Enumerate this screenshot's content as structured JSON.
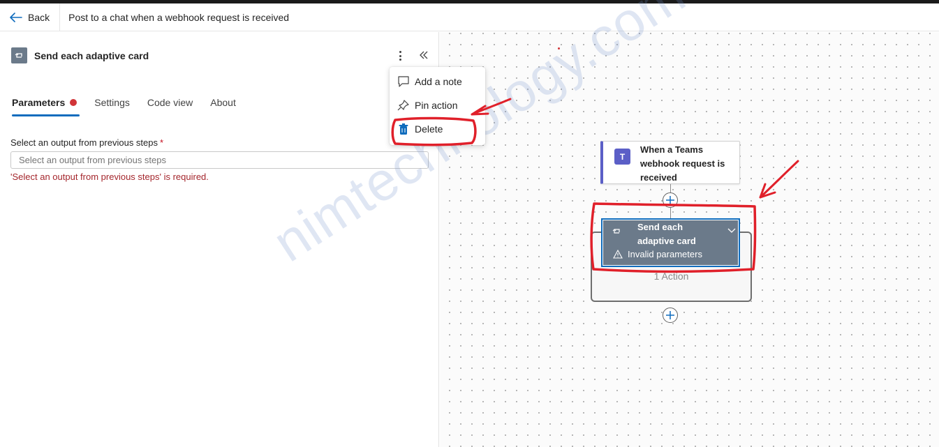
{
  "topbar": {
    "back_label": "Back",
    "flow_title": "Post to a chat when a webhook request is received"
  },
  "panel": {
    "title": "Send each adaptive card",
    "tabs": [
      {
        "label": "Parameters",
        "active": true,
        "has_error": true
      },
      {
        "label": "Settings"
      },
      {
        "label": "Code view"
      },
      {
        "label": "About"
      }
    ],
    "field": {
      "label": "Select an output from previous steps",
      "required_mark": "*",
      "placeholder": "Select an output from previous steps",
      "error": "'Select an output from previous steps' is required."
    }
  },
  "menu": {
    "items": [
      {
        "label": "Add a note",
        "icon": "note-icon"
      },
      {
        "label": "Pin action",
        "icon": "pin-icon"
      },
      {
        "label": "Delete",
        "icon": "trash-icon"
      }
    ]
  },
  "canvas": {
    "trigger": {
      "title": "When a Teams webhook request is received",
      "icon": "teams-icon",
      "icon_letter": "T"
    },
    "loop": {
      "title": "Send each adaptive card",
      "warning": "Invalid parameters"
    },
    "scope_label": "1 Action"
  },
  "watermark": "nimtechnology.com",
  "colors": {
    "accent": "#0f6cbd",
    "error": "#d13438",
    "teams": "#5b5fc7",
    "loop": "#6b7a8a",
    "annotation": "#e0202a"
  }
}
